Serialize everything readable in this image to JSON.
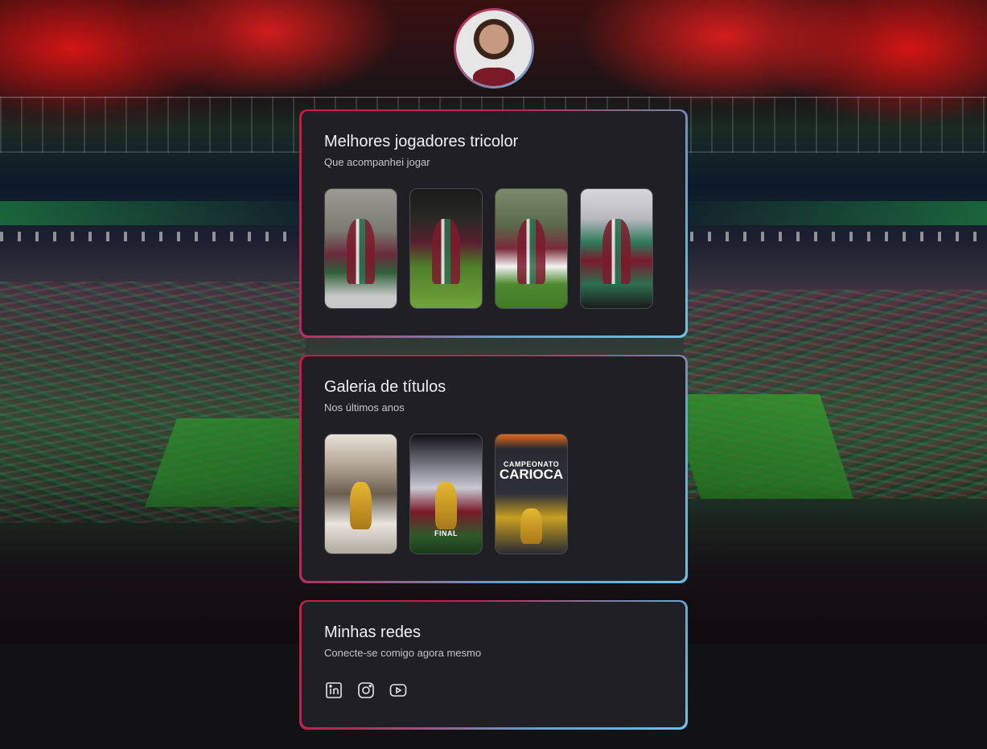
{
  "profile": {
    "avatar_alt": "Foto de perfil"
  },
  "cards": [
    {
      "title": "Melhores jogadores tricolor",
      "subtitle": "Que acompanhei jogar"
    },
    {
      "title": "Galeria de títulos",
      "subtitle": "Nos últimos anos",
      "trophy_text_small": "CAMPEONATO",
      "trophy_text_big": "CARIOCA",
      "final_text": "FINAL"
    },
    {
      "title": "Minhas redes",
      "subtitle": "Conecte-se comigo agora mesmo"
    }
  ],
  "socials": [
    "linkedin-icon",
    "instagram-icon",
    "youtube-icon"
  ],
  "colors": {
    "card_background": "#202024",
    "page_background": "#121214",
    "gradient_start": "#d01846",
    "gradient_end": "#6fc0e4",
    "title_text": "#f0f0f2",
    "subtitle_text": "#c4c4cc"
  }
}
